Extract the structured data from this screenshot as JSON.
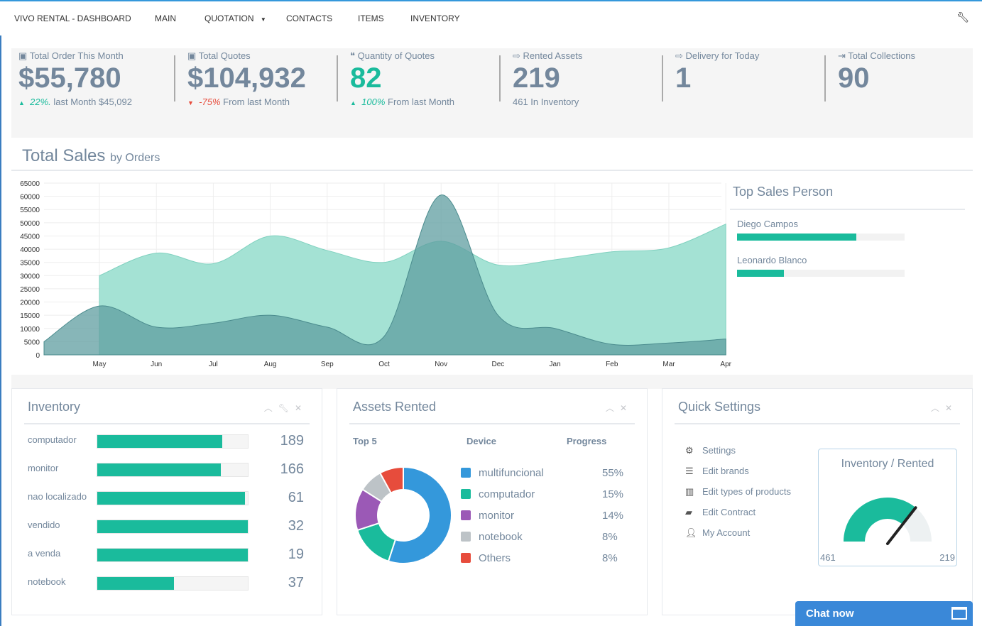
{
  "nav": {
    "brand": "VIVO RENTAL - DASHBOARD",
    "items": [
      "MAIN",
      "QUOTATION",
      "CONTACTS",
      "ITEMS",
      "INVENTORY"
    ],
    "settings_icon": "wrench-icon"
  },
  "stats": [
    {
      "icon": "money-icon",
      "label": "Total Order This Month",
      "value": "$55,780",
      "trend": "up",
      "change": "22%.",
      "sub": " last Month $45,092"
    },
    {
      "icon": "money-icon",
      "label": "Total Quotes",
      "value": "$104,932",
      "trend": "down",
      "change": "-75%",
      "sub": " From last Month"
    },
    {
      "icon": "quote-icon",
      "label": "Quantity of Quotes",
      "value": "82",
      "trend": "up",
      "change": "100%",
      "sub": " From last Month"
    },
    {
      "icon": "sign-out-icon",
      "label": "Rented Assets",
      "value": "219",
      "trend": "",
      "change": "",
      "sub": "461 In Inventory"
    },
    {
      "icon": "sign-out-icon",
      "label": "Delivery for Today",
      "value": "1",
      "trend": "",
      "change": "",
      "sub": ""
    },
    {
      "icon": "sign-in-icon",
      "label": "Total Collections",
      "value": "90",
      "trend": "",
      "change": "",
      "sub": ""
    }
  ],
  "sales": {
    "title": "Total Sales",
    "subtitle": "by Orders"
  },
  "chart_data": {
    "type": "area",
    "categories": [
      "",
      "May",
      "Jun",
      "Jul",
      "Aug",
      "Sep",
      "Oct",
      "Nov",
      "Dec",
      "Jan",
      "Feb",
      "Mar",
      "Apr"
    ],
    "ylim": [
      0,
      65000
    ],
    "yticks": [
      0,
      5000,
      10000,
      15000,
      20000,
      25000,
      30000,
      35000,
      40000,
      45000,
      50000,
      55000,
      60000,
      65000
    ],
    "grid": true,
    "series": [
      {
        "values": [
          null,
          30000,
          38500,
          34500,
          45000,
          39500,
          35000,
          43000,
          34000,
          36000,
          39000,
          40500,
          49500
        ],
        "color": "#9fe0d2"
      },
      {
        "values": [
          5000,
          18500,
          10500,
          12000,
          15000,
          10500,
          7000,
          60500,
          15000,
          10000,
          4000,
          4500,
          6000
        ],
        "color": "#5f9ea0"
      }
    ]
  },
  "top_sales": {
    "title": "Top Sales Person",
    "people": [
      {
        "name": "Diego Campos",
        "progress": 0.71
      },
      {
        "name": "Leonardo Blanco",
        "progress": 0.28
      }
    ]
  },
  "inventory": {
    "title": "Inventory",
    "rows": [
      {
        "label": "computador",
        "value": "189",
        "fill": 0.83
      },
      {
        "label": "monitor",
        "value": "166",
        "fill": 0.82
      },
      {
        "label": "nao localizado",
        "value": "61",
        "fill": 0.98
      },
      {
        "label": "vendido",
        "value": "32",
        "fill": 1
      },
      {
        "label": "a venda",
        "value": "19",
        "fill": 1
      },
      {
        "label": "notebook",
        "value": "37",
        "fill": 0.51
      }
    ]
  },
  "assets": {
    "title": "Assets Rented",
    "headers": [
      "Top 5",
      "Device",
      "Progress"
    ],
    "items": [
      {
        "label": "multifuncional",
        "pct": "55%",
        "value": 55,
        "color": "#3498db"
      },
      {
        "label": "computador",
        "pct": "15%",
        "value": 15,
        "color": "#1abb9c"
      },
      {
        "label": "monitor",
        "pct": "14%",
        "value": 14,
        "color": "#9b59b6"
      },
      {
        "label": "notebook",
        "pct": "8%",
        "value": 8,
        "color": "#bdc3c7"
      },
      {
        "label": "Others",
        "pct": "8%",
        "value": 8,
        "color": "#e74c3c"
      }
    ]
  },
  "quick": {
    "title": "Quick Settings",
    "items": [
      {
        "icon": "gear-icon",
        "label": "Settings"
      },
      {
        "icon": "list-icon",
        "label": "Edit brands"
      },
      {
        "icon": "bar-chart-icon",
        "label": "Edit types of products"
      },
      {
        "icon": "folder-open-icon",
        "label": "Edit Contract"
      },
      {
        "icon": "user-icon",
        "label": "My Account"
      }
    ],
    "gauge": {
      "title": "Inventory / Rented",
      "min_label": "461",
      "max_label": "219",
      "fill": 0.72
    }
  },
  "chat": {
    "label": "Chat now"
  }
}
